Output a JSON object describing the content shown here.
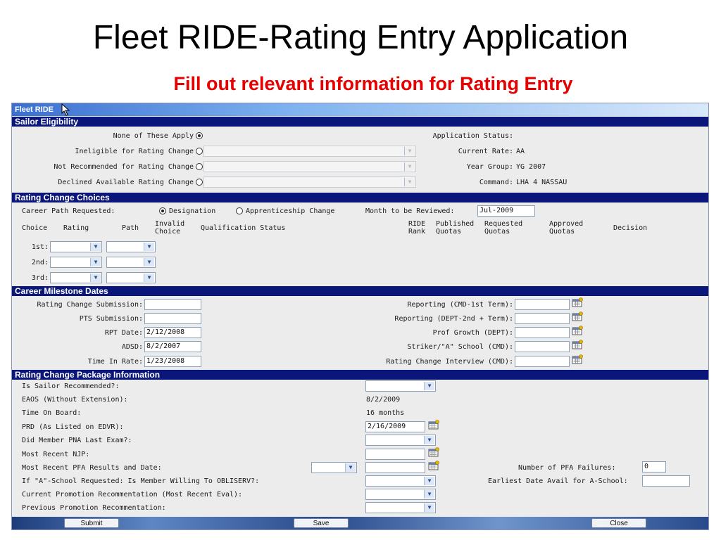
{
  "slide": {
    "title": "Fleet RIDE-Rating Entry Application",
    "subtitle": "Fill out relevant information for Rating Entry"
  },
  "app": {
    "title": "Fleet RIDE",
    "sections": {
      "eligibility": "Sailor Eligibility",
      "choices": "Rating Change Choices",
      "milestones": "Career Milestone Dates",
      "package": "Rating Change Package Information"
    }
  },
  "eligibility": {
    "options": [
      {
        "label": "None of These Apply",
        "selected": true
      },
      {
        "label": "Ineligible for Rating Change",
        "selected": false
      },
      {
        "label": "Not Recommended for Rating Change",
        "selected": false
      },
      {
        "label": "Declined Available Rating Change",
        "selected": false
      }
    ],
    "status": [
      {
        "label": "Application Status:",
        "value": ""
      },
      {
        "label": "Current Rate:",
        "value": "AA"
      },
      {
        "label": "Year Group:",
        "value": "YG 2007"
      },
      {
        "label": "Command:",
        "value": "LHA 4 NASSAU"
      }
    ]
  },
  "choices": {
    "career_path_label": "Career Path Requested:",
    "designation_label": "Designation",
    "apprenticeship_label": "Apprenticeship Change",
    "month_label": "Month to be Reviewed:",
    "month_value": "Jul-2009",
    "headers": {
      "choice": "Choice",
      "rating": "Rating",
      "path": "Path",
      "invalid1": "Invalid",
      "invalid2": "Choice",
      "qualification": "Qualification Status",
      "ride1": "RIDE",
      "ride2": "Rank",
      "published1": "Published",
      "published2": "Quotas",
      "requested1": "Requested",
      "requested2": "Quotas",
      "approved1": "Approved",
      "approved2": "Quotas",
      "decision": "Decision"
    },
    "rows": [
      "1st:",
      "2nd:",
      "3rd:"
    ]
  },
  "milestones": {
    "left": [
      {
        "label": "Rating Change Submission:",
        "value": ""
      },
      {
        "label": "PTS Submission:",
        "value": ""
      },
      {
        "label": "RPT Date:",
        "value": "2/12/2008"
      },
      {
        "label": "ADSD:",
        "value": "8/2/2007"
      },
      {
        "label": "Time In Rate:",
        "value": "1/23/2008"
      }
    ],
    "right": [
      {
        "label": "Reporting (CMD-1st Term):",
        "value": ""
      },
      {
        "label": "Reporting (DEPT-2nd + Term):",
        "value": ""
      },
      {
        "label": "Prof Growth (DEPT):",
        "value": ""
      },
      {
        "label": "Striker/\"A\" School (CMD):",
        "value": ""
      },
      {
        "label": "Rating Change Interview (CMD):",
        "value": ""
      }
    ]
  },
  "package": {
    "rows": [
      {
        "label": "Is Sailor Recommended?:",
        "value": ""
      },
      {
        "label": "EAOS (Without Extension):",
        "value": "8/2/2009"
      },
      {
        "label": "Time On Board:",
        "value": "16 months"
      },
      {
        "label": "PRD (As Listed on EDVR):",
        "value": "2/16/2009"
      },
      {
        "label": "Did Member PNA Last Exam?:",
        "value": ""
      },
      {
        "label": "Most Recent NJP:",
        "value": ""
      },
      {
        "label": "Most Recent PFA Results and Date:",
        "value": ""
      },
      {
        "label": "If \"A\"-School Requested: Is Member Willing To OBLISERV?:",
        "value": ""
      },
      {
        "label": "Current Promotion Recommentation (Most Recent Eval):",
        "value": ""
      },
      {
        "label": "Previous Promotion Recommentation:",
        "value": ""
      }
    ],
    "pfa_failures_label": "Number of PFA Failures:",
    "pfa_failures_value": "0",
    "earliest_label": "Earliest Date Avail for A-School:",
    "earliest_value": ""
  },
  "buttons": {
    "submit": "Submit",
    "save": "Save",
    "close": "Close"
  }
}
